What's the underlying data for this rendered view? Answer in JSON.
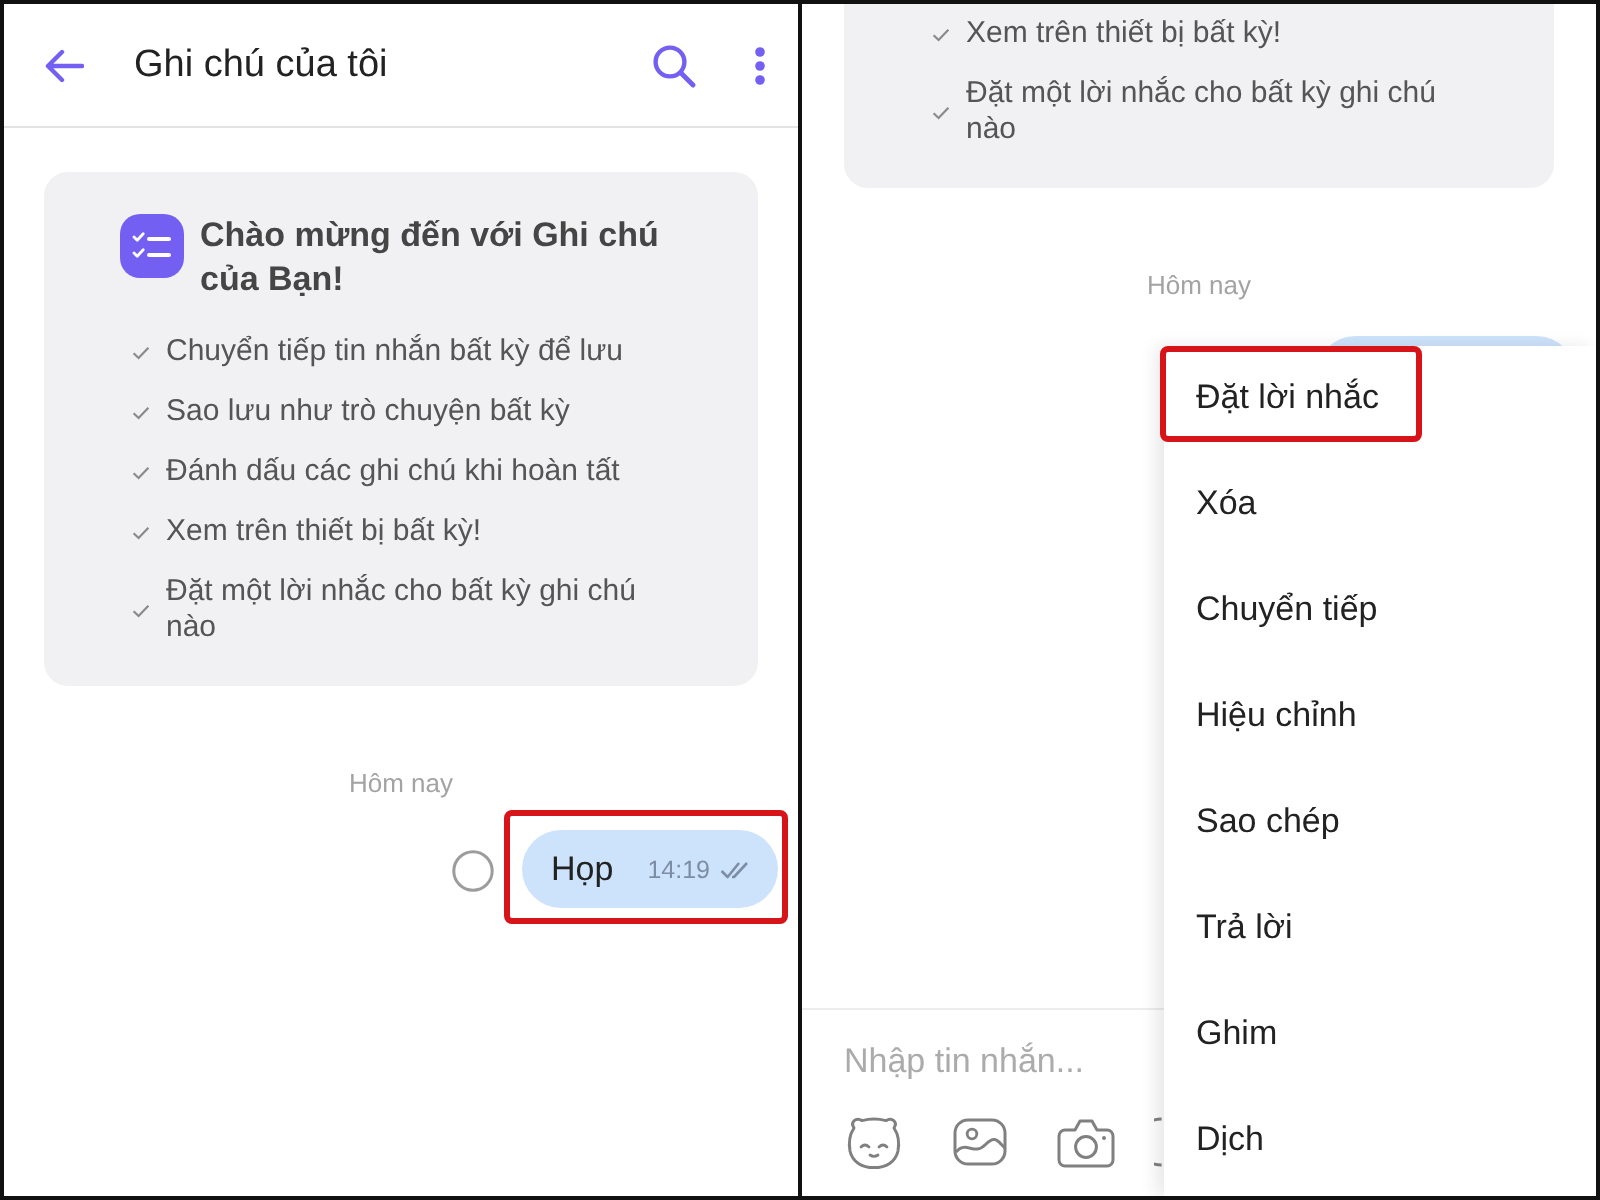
{
  "left_screen": {
    "header": {
      "title": "Ghi chú của tôi"
    },
    "welcome_card": {
      "title": "Chào mừng đến với Ghi chú của Bạn!",
      "items": [
        "Chuyển tiếp tin nhắn bất kỳ để lưu",
        "Sao lưu như trò chuyện bất kỳ",
        "Đánh dấu các ghi chú khi hoàn tất",
        "Xem trên thiết bị bất kỳ!",
        "Đặt một lời nhắc cho bất kỳ ghi chú nào"
      ]
    },
    "date_label": "Hôm nay",
    "message": {
      "text": "Họp",
      "time": "14:19",
      "selected": false,
      "highlighted": true
    }
  },
  "right_screen": {
    "welcome_card": {
      "items": [
        "Xem trên thiết bị bất kỳ!",
        "Đặt một lời nhắc cho bất kỳ ghi chú nào"
      ]
    },
    "date_label": "Hôm nay",
    "composer": {
      "placeholder": "Nhập tin nhắn..."
    },
    "context_menu": {
      "items": [
        {
          "label": "Đặt lời nhắc",
          "highlighted": true
        },
        {
          "label": "Xóa",
          "highlighted": false
        },
        {
          "label": "Chuyển tiếp",
          "highlighted": false
        },
        {
          "label": "Hiệu chỉnh",
          "highlighted": false
        },
        {
          "label": "Sao chép",
          "highlighted": false
        },
        {
          "label": "Trả lời",
          "highlighted": false
        },
        {
          "label": "Ghim",
          "highlighted": false
        },
        {
          "label": "Dịch",
          "highlighted": false
        }
      ]
    }
  }
}
